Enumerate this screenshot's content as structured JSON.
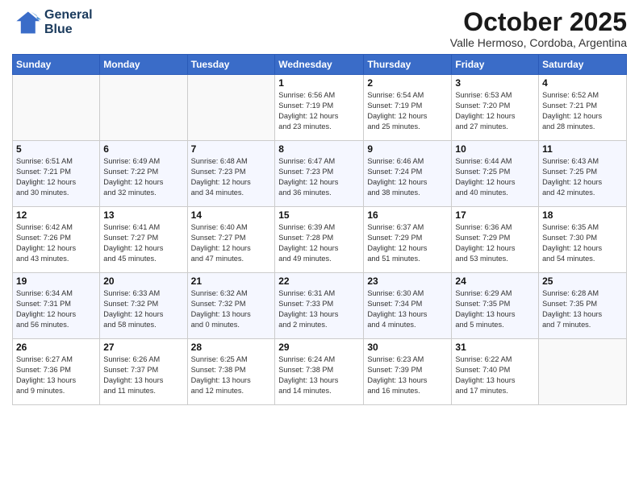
{
  "logo": {
    "line1": "General",
    "line2": "Blue"
  },
  "title": "October 2025",
  "subtitle": "Valle Hermoso, Cordoba, Argentina",
  "weekdays": [
    "Sunday",
    "Monday",
    "Tuesday",
    "Wednesday",
    "Thursday",
    "Friday",
    "Saturday"
  ],
  "weeks": [
    [
      {
        "day": "",
        "info": ""
      },
      {
        "day": "",
        "info": ""
      },
      {
        "day": "",
        "info": ""
      },
      {
        "day": "1",
        "info": "Sunrise: 6:56 AM\nSunset: 7:19 PM\nDaylight: 12 hours\nand 23 minutes."
      },
      {
        "day": "2",
        "info": "Sunrise: 6:54 AM\nSunset: 7:19 PM\nDaylight: 12 hours\nand 25 minutes."
      },
      {
        "day": "3",
        "info": "Sunrise: 6:53 AM\nSunset: 7:20 PM\nDaylight: 12 hours\nand 27 minutes."
      },
      {
        "day": "4",
        "info": "Sunrise: 6:52 AM\nSunset: 7:21 PM\nDaylight: 12 hours\nand 28 minutes."
      }
    ],
    [
      {
        "day": "5",
        "info": "Sunrise: 6:51 AM\nSunset: 7:21 PM\nDaylight: 12 hours\nand 30 minutes."
      },
      {
        "day": "6",
        "info": "Sunrise: 6:49 AM\nSunset: 7:22 PM\nDaylight: 12 hours\nand 32 minutes."
      },
      {
        "day": "7",
        "info": "Sunrise: 6:48 AM\nSunset: 7:23 PM\nDaylight: 12 hours\nand 34 minutes."
      },
      {
        "day": "8",
        "info": "Sunrise: 6:47 AM\nSunset: 7:23 PM\nDaylight: 12 hours\nand 36 minutes."
      },
      {
        "day": "9",
        "info": "Sunrise: 6:46 AM\nSunset: 7:24 PM\nDaylight: 12 hours\nand 38 minutes."
      },
      {
        "day": "10",
        "info": "Sunrise: 6:44 AM\nSunset: 7:25 PM\nDaylight: 12 hours\nand 40 minutes."
      },
      {
        "day": "11",
        "info": "Sunrise: 6:43 AM\nSunset: 7:25 PM\nDaylight: 12 hours\nand 42 minutes."
      }
    ],
    [
      {
        "day": "12",
        "info": "Sunrise: 6:42 AM\nSunset: 7:26 PM\nDaylight: 12 hours\nand 43 minutes."
      },
      {
        "day": "13",
        "info": "Sunrise: 6:41 AM\nSunset: 7:27 PM\nDaylight: 12 hours\nand 45 minutes."
      },
      {
        "day": "14",
        "info": "Sunrise: 6:40 AM\nSunset: 7:27 PM\nDaylight: 12 hours\nand 47 minutes."
      },
      {
        "day": "15",
        "info": "Sunrise: 6:39 AM\nSunset: 7:28 PM\nDaylight: 12 hours\nand 49 minutes."
      },
      {
        "day": "16",
        "info": "Sunrise: 6:37 AM\nSunset: 7:29 PM\nDaylight: 12 hours\nand 51 minutes."
      },
      {
        "day": "17",
        "info": "Sunrise: 6:36 AM\nSunset: 7:29 PM\nDaylight: 12 hours\nand 53 minutes."
      },
      {
        "day": "18",
        "info": "Sunrise: 6:35 AM\nSunset: 7:30 PM\nDaylight: 12 hours\nand 54 minutes."
      }
    ],
    [
      {
        "day": "19",
        "info": "Sunrise: 6:34 AM\nSunset: 7:31 PM\nDaylight: 12 hours\nand 56 minutes."
      },
      {
        "day": "20",
        "info": "Sunrise: 6:33 AM\nSunset: 7:32 PM\nDaylight: 12 hours\nand 58 minutes."
      },
      {
        "day": "21",
        "info": "Sunrise: 6:32 AM\nSunset: 7:32 PM\nDaylight: 13 hours\nand 0 minutes."
      },
      {
        "day": "22",
        "info": "Sunrise: 6:31 AM\nSunset: 7:33 PM\nDaylight: 13 hours\nand 2 minutes."
      },
      {
        "day": "23",
        "info": "Sunrise: 6:30 AM\nSunset: 7:34 PM\nDaylight: 13 hours\nand 4 minutes."
      },
      {
        "day": "24",
        "info": "Sunrise: 6:29 AM\nSunset: 7:35 PM\nDaylight: 13 hours\nand 5 minutes."
      },
      {
        "day": "25",
        "info": "Sunrise: 6:28 AM\nSunset: 7:35 PM\nDaylight: 13 hours\nand 7 minutes."
      }
    ],
    [
      {
        "day": "26",
        "info": "Sunrise: 6:27 AM\nSunset: 7:36 PM\nDaylight: 13 hours\nand 9 minutes."
      },
      {
        "day": "27",
        "info": "Sunrise: 6:26 AM\nSunset: 7:37 PM\nDaylight: 13 hours\nand 11 minutes."
      },
      {
        "day": "28",
        "info": "Sunrise: 6:25 AM\nSunset: 7:38 PM\nDaylight: 13 hours\nand 12 minutes."
      },
      {
        "day": "29",
        "info": "Sunrise: 6:24 AM\nSunset: 7:38 PM\nDaylight: 13 hours\nand 14 minutes."
      },
      {
        "day": "30",
        "info": "Sunrise: 6:23 AM\nSunset: 7:39 PM\nDaylight: 13 hours\nand 16 minutes."
      },
      {
        "day": "31",
        "info": "Sunrise: 6:22 AM\nSunset: 7:40 PM\nDaylight: 13 hours\nand 17 minutes."
      },
      {
        "day": "",
        "info": ""
      }
    ]
  ]
}
